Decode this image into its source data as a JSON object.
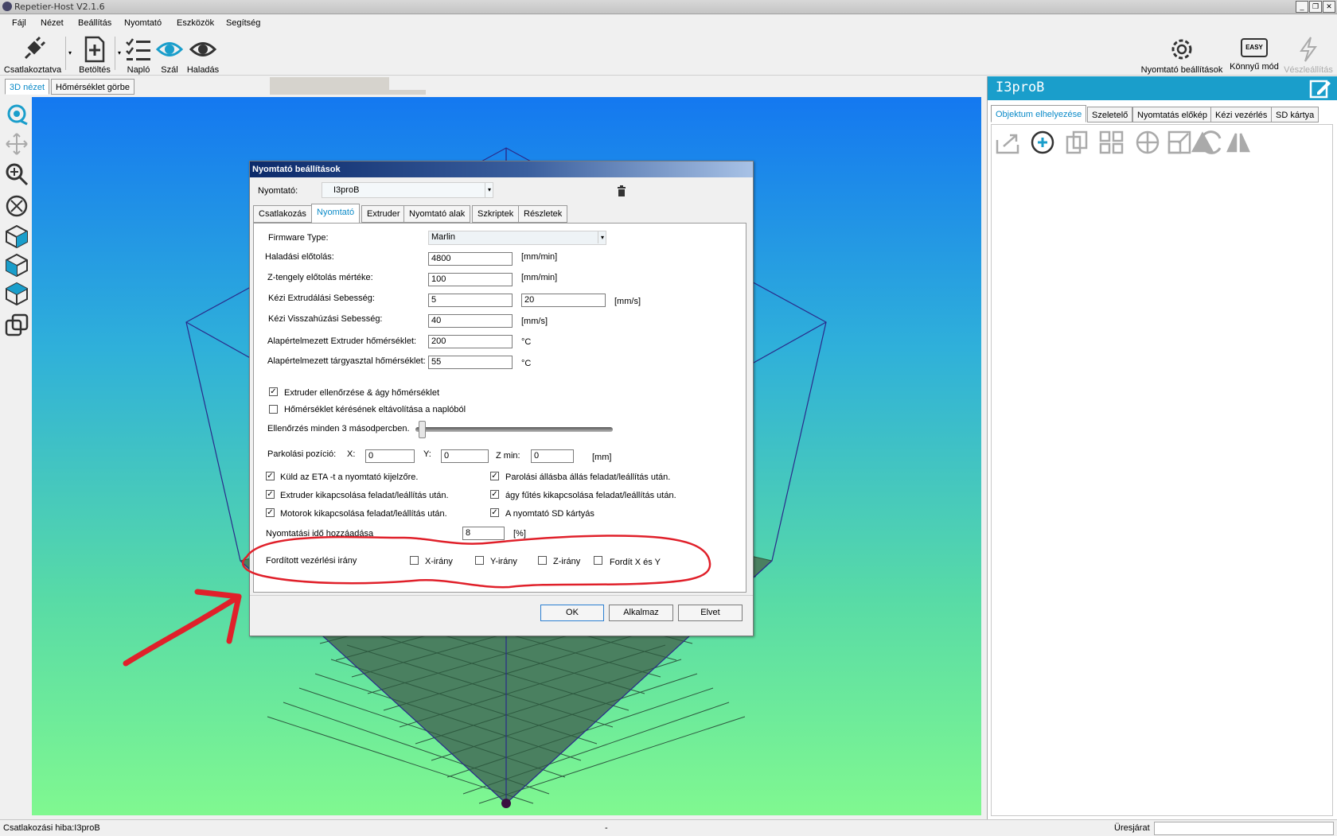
{
  "window": {
    "title": "Repetier-Host V2.1.6"
  },
  "menu": [
    "Fájl",
    "Nézet",
    "Beállítás",
    "Nyomtató",
    "Eszközök",
    "Segítség"
  ],
  "toolbar": {
    "connect": "Csatlakoztatva",
    "load": "Betöltés",
    "log": "Napló",
    "filament": "Szál",
    "advanced": "Haladás",
    "printer_settings": "Nyomtató beállítások",
    "easy_mode": "Könnyű mód",
    "easy_badge": "EASY",
    "emergency": "Vészleállítás"
  },
  "left_tabs": {
    "view3d": "3D nézet",
    "temp_curve": "Hőmérséklet görbe"
  },
  "right_panel": {
    "title": "I3proB",
    "tabs": [
      "Objektum elhelyezése",
      "Szeletelő",
      "Nyomtatás előkép",
      "Kézi vezérlés",
      "SD kártya"
    ]
  },
  "dialog": {
    "title": "Nyomtató beállítások",
    "printer_label": "Nyomtató:",
    "printer_value": "I3proB",
    "tabs": [
      "Csatlakozás",
      "Nyomtató",
      "Extruder",
      "Nyomtató alak",
      "Szkriptek",
      "Részletek"
    ],
    "firmware_label": "Firmware Type:",
    "firmware_value": "Marlin",
    "travel_label": "Haladási előtolás:",
    "travel_value": "4800",
    "travel_unit": "[mm/min]",
    "z_label": "Z-tengely előtolás mértéke:",
    "z_value": "100",
    "z_unit": "[mm/min]",
    "extr_label": "Kézi Extrudálási Sebesség:",
    "extr_value1": "5",
    "extr_value2": "20",
    "extr_unit": "[mm/s]",
    "retract_label": "Kézi Visszahúzási Sebesség:",
    "retract_value": "40",
    "retract_unit": "[mm/s]",
    "ext_temp_label": "Alapértelmezett Extruder hőmérséklet:",
    "ext_temp_value": "200",
    "ext_temp_unit": "°C",
    "bed_temp_label": "Alapértelmezett tárgyasztal hőmérséklet:",
    "bed_temp_value": "55",
    "bed_temp_unit": "°C",
    "chk_extruder_check": "Extruder ellenőrzése & ágy hőmérséklet",
    "chk_remove_temp": "Hőmérséklet kérésének eltávolítása a naplóból",
    "check_interval": "Ellenőrzés minden 3 másodpercben.",
    "park_label": "Parkolási pozíció:",
    "park_x_label": "X:",
    "park_x": "0",
    "park_y_label": "Y:",
    "park_y": "0",
    "park_z_label": "Z min:",
    "park_z": "0",
    "park_unit": "[mm]",
    "chk_eta": "Küld az ETA -t a nyomtató kijelzőre.",
    "chk_park": "Parolási állásba állás feladat/leállítás után.",
    "chk_extruder_off": "Extruder kikapcsolása feladat/leállítás után.",
    "chk_bed_off": "ágy fűtés kikapcsolása feladat/leállítás után.",
    "chk_motors_off": "Motorok kikapcsolása feladat/leállítás után.",
    "chk_sd": "A nyomtató SD kártyás",
    "print_time_label": "Nyomtatási idő hozzáadása",
    "print_time_value": "8",
    "print_time_unit": "[%]",
    "invert_label": "Fordított vezérlési irány",
    "inv_x": "X-irány",
    "inv_y": "Y-irány",
    "inv_z": "Z-irány",
    "inv_xy": "Fordít X és Y",
    "ok": "OK",
    "apply": "Alkalmaz",
    "cancel": "Elvet"
  },
  "status": {
    "left": "Csatlakozási hiba:I3proB",
    "middle": "-",
    "right": "Üresjárat"
  },
  "colors": {
    "accent": "#1a9ecb",
    "annotation": "#e0202a"
  }
}
